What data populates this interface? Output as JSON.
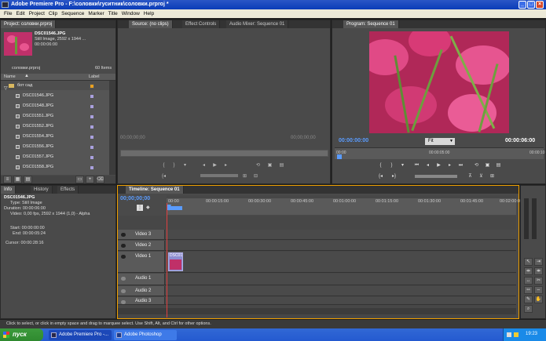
{
  "window": {
    "title": "Adobe Premiere Pro - F:\\соловки\\гуситник\\соловки.prproj *"
  },
  "menu": [
    "File",
    "Edit",
    "Project",
    "Clip",
    "Sequence",
    "Marker",
    "Title",
    "Window",
    "Help"
  ],
  "project_panel": {
    "tab": "Project: соловки.prproj",
    "preview_name": "DSC01546.JPG",
    "preview_type": "Still Image, 2592 x 1944 ...",
    "preview_duration": "00:00:06:00",
    "project_file": "соловки.prproj",
    "item_count": "60 Items",
    "col_name": "Name",
    "col_label": "Label",
    "folder": "бот сад",
    "files": [
      "DSC01546.JPG",
      "DSC01548.JPG",
      "DSC01551.JPG",
      "DSC01552.JPG",
      "DSC01554.JPG",
      "DSC01556.JPG",
      "DSC01557.JPG",
      "DSC01558.JPG"
    ],
    "label_color": "#a9a0dd"
  },
  "source_panel": {
    "tabs": [
      "Source: (no clips)",
      "Effect Controls",
      "Audio Mixer: Sequence 01"
    ],
    "time_left": "00;00;00;00",
    "time_right": "00;00;00;00"
  },
  "program_panel": {
    "tab": "Program: Sequence 01",
    "time_left": "00:00:00:00",
    "fit": "Fit",
    "time_right": "00:00:06:00",
    "ruler_left": "00:00",
    "ruler_mid": "00:00:05:00",
    "ruler_right": "00:00:10"
  },
  "info_panel": {
    "tabs": [
      "Info",
      "History",
      "Effects"
    ],
    "name": "DSC01546.JPG",
    "type": "Type: Still Image",
    "duration": "Duration: 00:00:06:00",
    "video": "Video: 0,00 fps, 2592 x 1944 (1,0) - Alpha",
    "start": "Start: 00:00:00:00",
    "end": "End: 00:00:05:24",
    "cursor": "Cursor: 00:00:28:16"
  },
  "timeline": {
    "tab": "Timeline: Sequence 01",
    "timecode": "00;00;00;00",
    "ruler": [
      "00:00",
      "00:00:15:00",
      "00:00:30:00",
      "00:00:45:00",
      "00:01:00:00",
      "00:01:15:00",
      "00:01:30:00",
      "00:01:45:00",
      "00:02:00:00"
    ],
    "tracks": [
      "Video 3",
      "Video 2",
      "Video 1",
      "Audio 1",
      "Audio 2",
      "Audio 3"
    ],
    "clip_label": "DSC01"
  },
  "status": "Click to select, or click in empty space and drag to marquee select. Use Shift, Alt, and Ctrl for other options.",
  "taskbar": {
    "start": "пуск",
    "items": [
      "Adobe Premiere Pro -...",
      "Adobe Photoshop"
    ],
    "clock": "19:23"
  },
  "colors": {
    "accent": "#f0a000",
    "playhead": "#e04040",
    "timecode_blue": "#5a9cff"
  }
}
